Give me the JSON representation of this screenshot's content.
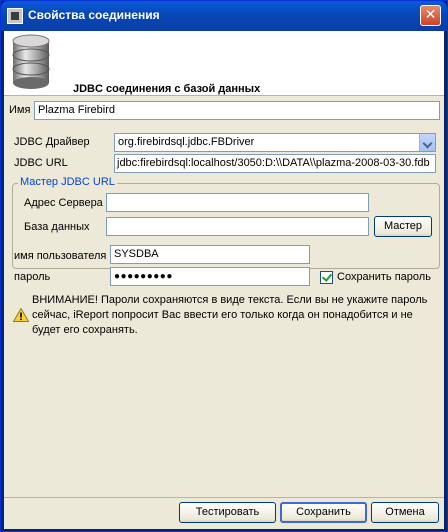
{
  "window": {
    "title": "Свойства соединения",
    "close_glyph": "✕"
  },
  "header": {
    "title": "JDBC соединения с базой данных",
    "icon": "database-icon"
  },
  "form": {
    "name_label": "Имя",
    "name_value": "Plazma Firebird",
    "driver_label": "JDBC Драйвер",
    "driver_value": "org.firebirdsql.jdbc.FBDriver",
    "url_label": "JDBC URL",
    "url_value": "jdbc:firebirdsql:localhost/3050:D:\\\\DATA\\\\plazma-2008-03-30.fdb"
  },
  "wizard": {
    "title": "Мастер JDBC URL",
    "server_label": "Адрес Сервера",
    "server_value": "",
    "database_label": "База данных",
    "database_value": "",
    "button_label": "Мастер"
  },
  "auth": {
    "user_label": "имя пользователя",
    "user_value": "SYSDBA",
    "password_label": "пароль",
    "password_value": "●●●●●●●●●",
    "save_password_label": "Сохранить пароль",
    "save_password_checked": true
  },
  "warning": {
    "text": "ВНИМАНИЕ! Пароли сохраняются в виде текста. Если вы не укажите пароль сейчас, iReport попросит Вас ввести его только когда он понадобится и не будет его сохранять."
  },
  "buttons": {
    "test": "Тестировать",
    "save": "Сохранить",
    "cancel": "Отмена"
  }
}
